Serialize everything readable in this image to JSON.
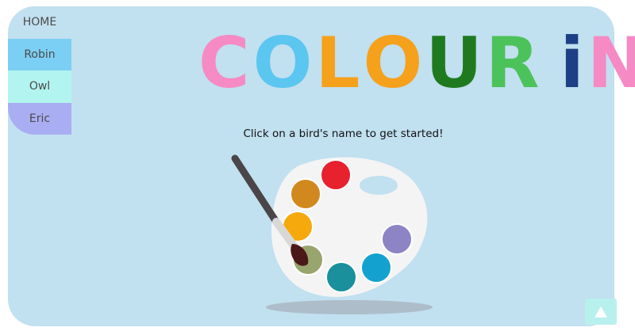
{
  "nav": {
    "items": [
      {
        "label": "HOME"
      },
      {
        "label": "Robin"
      },
      {
        "label": "Owl"
      },
      {
        "label": "Eric"
      }
    ]
  },
  "title": {
    "letters": [
      "C",
      "O",
      "L",
      "O",
      "U",
      "R",
      "i",
      "N"
    ],
    "colors": [
      "#f58ac5",
      "#5bc6ef",
      "#f5a11c",
      "#f5a11c",
      "#1f7a1f",
      "#4cc25b",
      "#1d3f86",
      "#f58ac5"
    ]
  },
  "instruction": "Click on a bird's name to get started!",
  "palette": {
    "wells": [
      "#e8212f",
      "#d1891f",
      "#f5a90c",
      "#98a56f",
      "#19909c",
      "#13a2d0",
      "#8d84c6"
    ],
    "board_color": "#f4f4f4",
    "brush_handle_color": "#4a4548",
    "brush_tip_color": "#4a1818"
  },
  "icons": {
    "scroll_top": "arrow-up-icon"
  }
}
